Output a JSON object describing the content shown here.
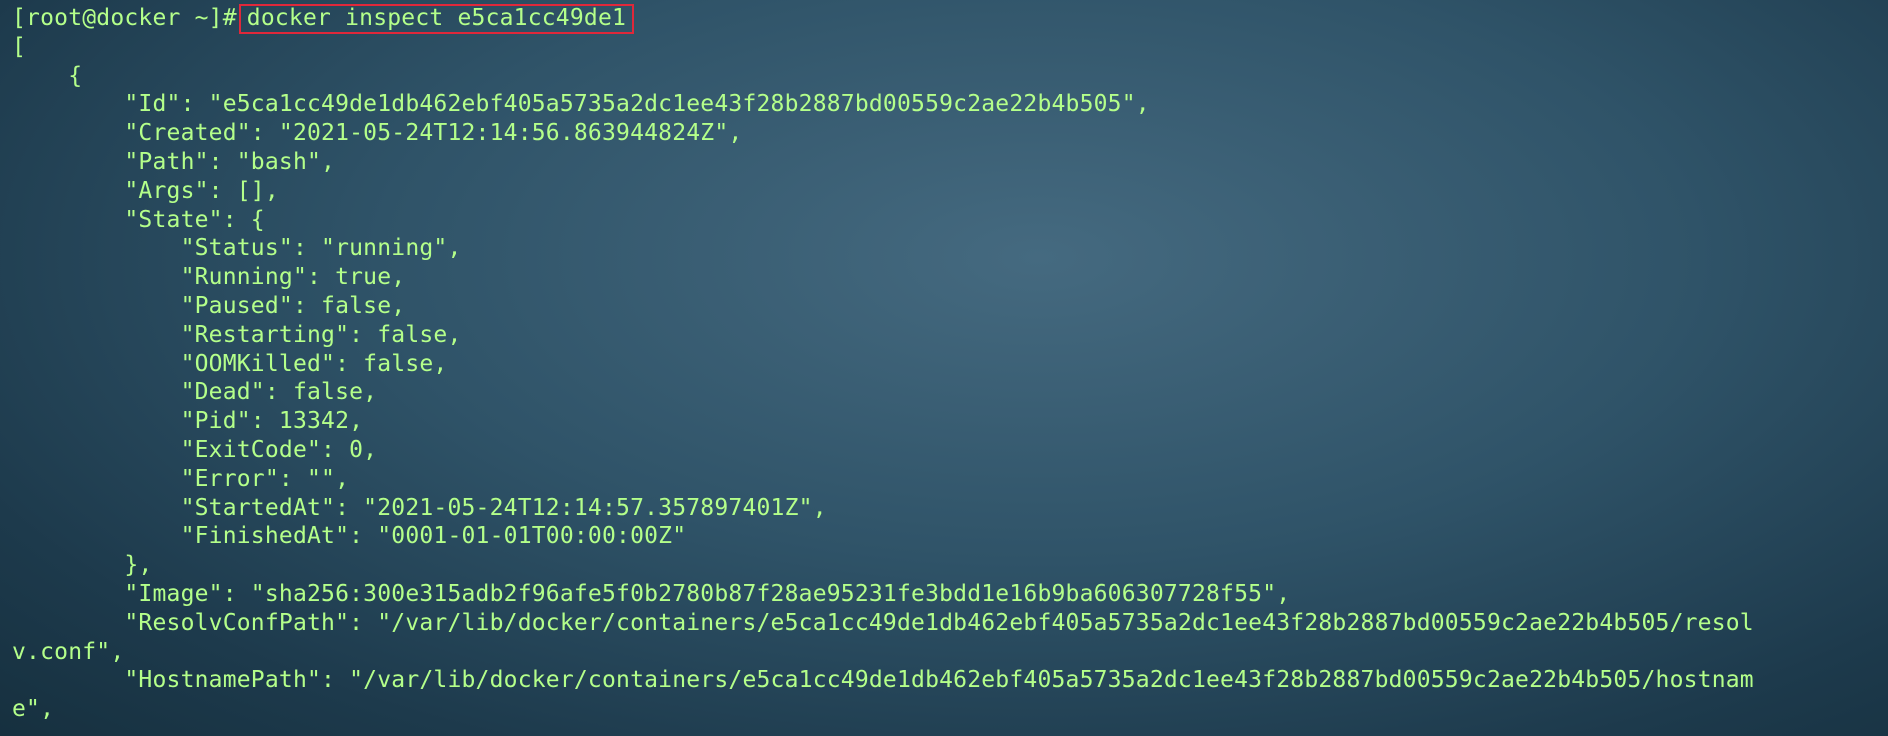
{
  "terminal": {
    "prompt": "[root@docker ~]#",
    "command": "docker inspect e5ca1cc49de1",
    "output": [
      "[",
      "    {",
      "        \"Id\": \"e5ca1cc49de1db462ebf405a5735a2dc1ee43f28b2887bd00559c2ae22b4b505\",",
      "        \"Created\": \"2021-05-24T12:14:56.863944824Z\",",
      "        \"Path\": \"bash\",",
      "        \"Args\": [],",
      "        \"State\": {",
      "            \"Status\": \"running\",",
      "            \"Running\": true,",
      "            \"Paused\": false,",
      "            \"Restarting\": false,",
      "            \"OOMKilled\": false,",
      "            \"Dead\": false,",
      "            \"Pid\": 13342,",
      "            \"ExitCode\": 0,",
      "            \"Error\": \"\",",
      "            \"StartedAt\": \"2021-05-24T12:14:57.357897401Z\",",
      "            \"FinishedAt\": \"0001-01-01T00:00:00Z\"",
      "        },",
      "        \"Image\": \"sha256:300e315adb2f96afe5f0b2780b87f28ae95231fe3bdd1e16b9ba606307728f55\",",
      "        \"ResolvConfPath\": \"/var/lib/docker/containers/e5ca1cc49de1db462ebf405a5735a2dc1ee43f28b2887bd00559c2ae22b4b505/resol",
      "v.conf\",",
      "        \"HostnamePath\": \"/var/lib/docker/containers/e5ca1cc49de1db462ebf405a5735a2dc1ee43f28b2887bd00559c2ae22b4b505/hostnam",
      "e\","
    ],
    "colors": {
      "text": "#b4ff8a",
      "highlight_border": "#e0283a",
      "background": "#2f5368"
    }
  }
}
